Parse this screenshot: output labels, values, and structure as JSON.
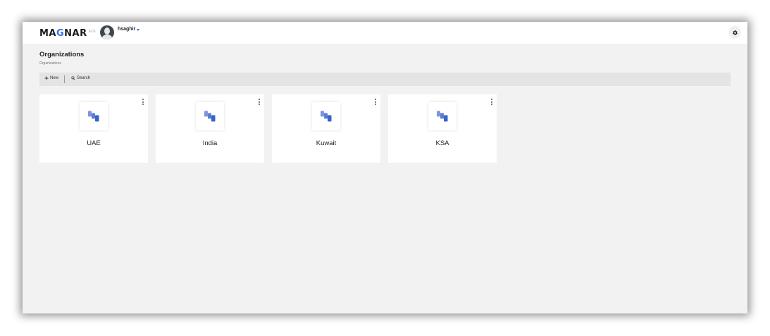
{
  "app": {
    "logo_prefix": "MA",
    "logo_accent": "G",
    "logo_suffix": "NAR",
    "logo_sup": "BETA",
    "accent_color": "#2f6fe0"
  },
  "user": {
    "name": "hsaghir"
  },
  "page": {
    "title": "Organizations",
    "breadcrumb": "Organizations"
  },
  "toolbar": {
    "new_label": "New",
    "search_label": "Search"
  },
  "organizations": [
    {
      "name": "UAE",
      "icon": "folders-icon"
    },
    {
      "name": "India",
      "icon": "folders-icon"
    },
    {
      "name": "Kuwait",
      "icon": "folders-icon"
    },
    {
      "name": "KSA",
      "icon": "folders-icon"
    }
  ]
}
